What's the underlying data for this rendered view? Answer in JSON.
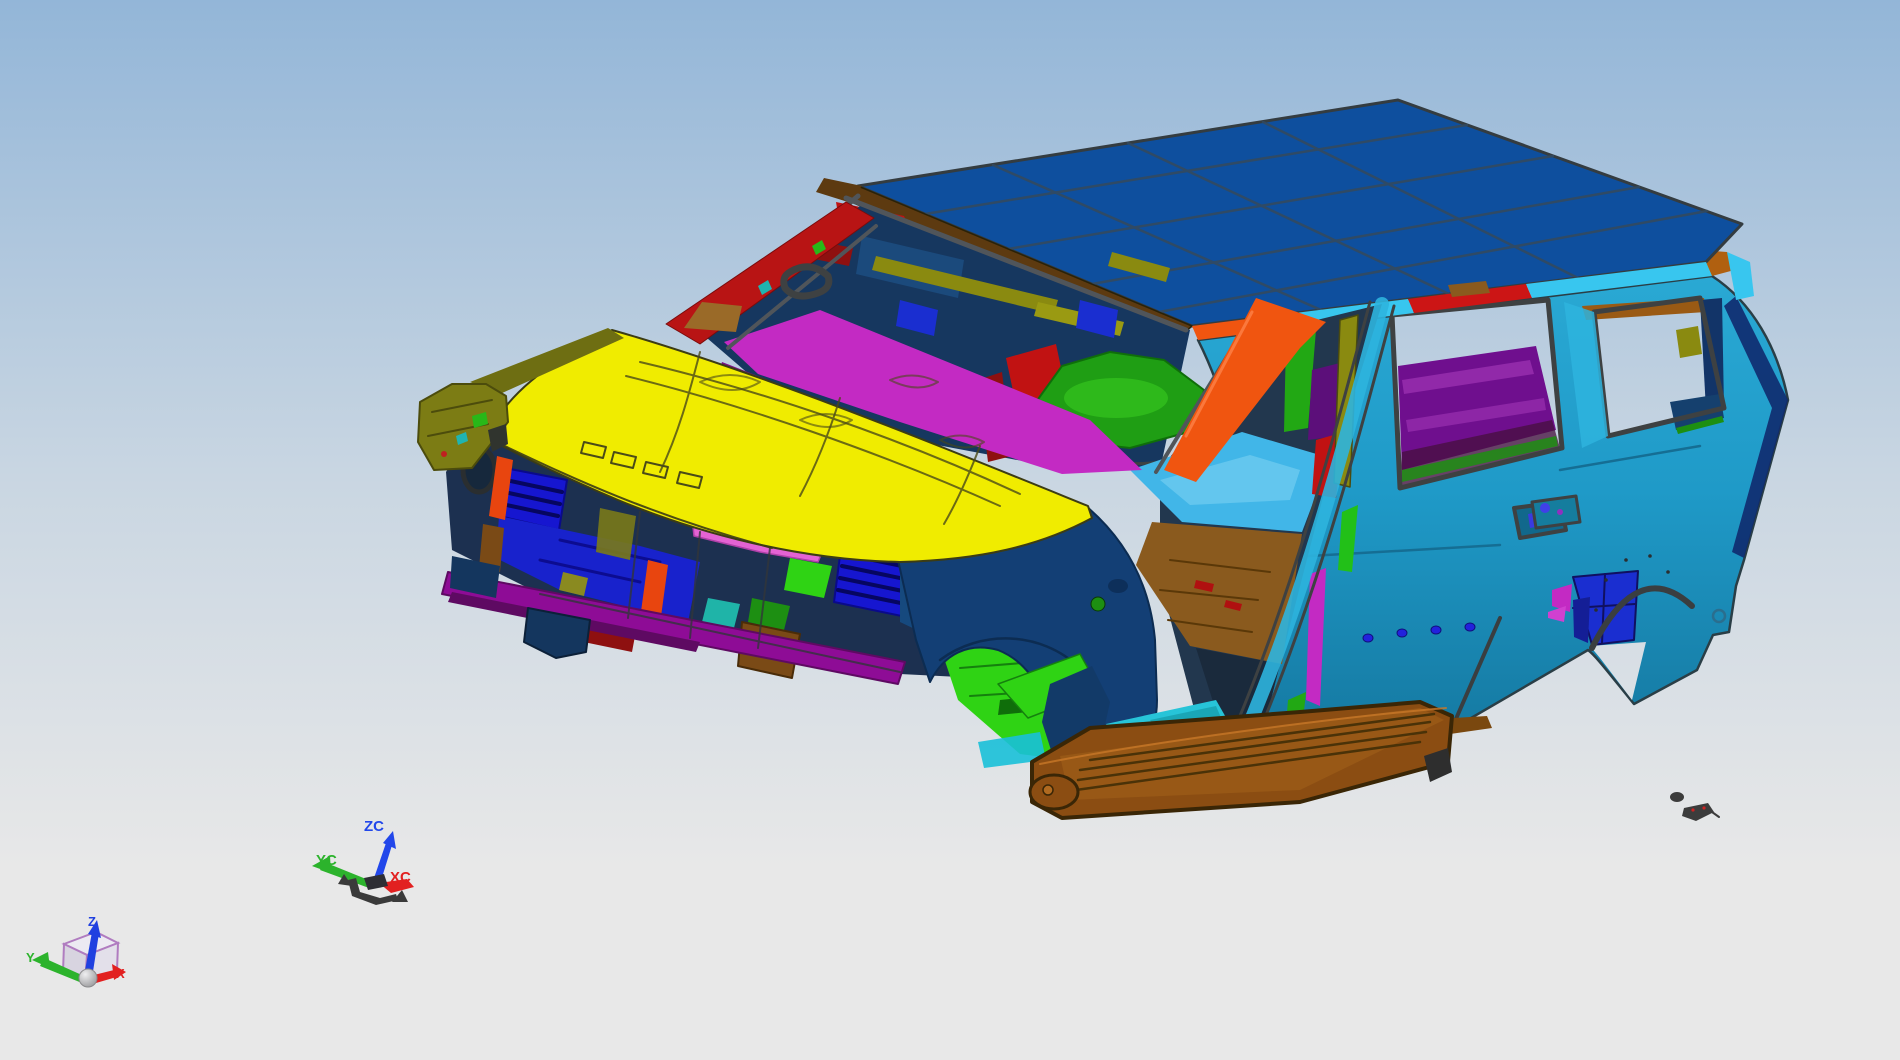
{
  "viewport": {
    "type": "cad-3d-viewport",
    "model_name": "suv-body-in-white",
    "background": {
      "top": "#93b6d8",
      "middle": "#c9d6e2",
      "bottom": "#e8e8e8"
    }
  },
  "wcs_triad": {
    "z_label": "ZC",
    "y_label": "YC",
    "x_label": "XC",
    "z_color": "#2247ea",
    "y_color": "#2cb32c",
    "x_color": "#e22020",
    "handle_color": "#3a3a3a"
  },
  "view_triad": {
    "z_label": "Z",
    "y_label": "Y",
    "x_label": "X",
    "z_color": "#2040e0",
    "y_color": "#2cb32c",
    "x_color": "#e22020",
    "cube_edge": "#b07cc0",
    "cube_face": "#e9e6f0",
    "origin_sphere": "#c9c9cc"
  },
  "model": {
    "colors": {
      "roof": "#0e4f9e",
      "roof_lines": "#33495e",
      "header_rail": "#5d3a10",
      "edge_cyan": "#38c6ef",
      "edge_orange": "#f05510",
      "edge_red": "#cc1515",
      "body_teal_light": "#2aa9d4",
      "body_teal": "#1f9ac8",
      "body_teal_dark": "#14769e",
      "pillar_cyan": "#2eb4de",
      "hood": "#f0ec00",
      "hood_lines": "#4a4a18",
      "fender_navy": "#133f75",
      "fender_olive": "#7c7c14",
      "grille_blue": "#1616d0",
      "bumper_magenta": "#8e0c96",
      "cowl_magenta": "#c32ac3",
      "apillar_red": "#b81414",
      "apillar_orange": "#f05510",
      "floor_brown": "#8a5a1e",
      "step_brown": "#8b4d12",
      "floor_green": "#2fd314",
      "dash_green": "#1f9e14",
      "floor_cyan": "#41b6e8",
      "sill_cyan": "#27c4d8",
      "interior_navy": "#16375f",
      "cargo_purple": "#6f0f8e",
      "arch_blue": "#1a2ed0",
      "olive_trim": "#8a8a10",
      "pink": "#e463d4",
      "red": "#c11212",
      "dark_red": "#8e1010",
      "orange": "#e8450f",
      "teal": "#1fb4a8",
      "plug_blue": "#2222dd",
      "debris": "#3c3c3c"
    }
  }
}
